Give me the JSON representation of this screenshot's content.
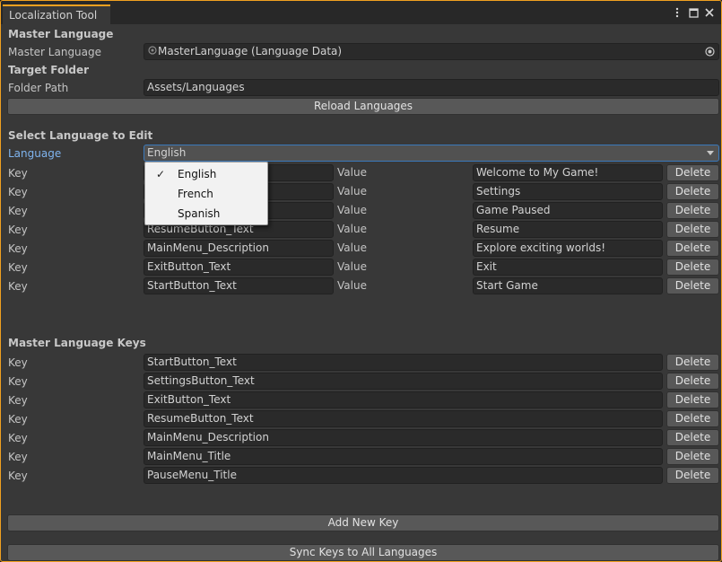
{
  "window": {
    "tab_title": "Localization Tool",
    "icons": [
      "kebab-menu-icon",
      "maximize-icon",
      "close-icon"
    ]
  },
  "master_language_section": {
    "header": "Master Language",
    "field_label": "Master Language",
    "field_value": "MasterLanguage (Language Data)"
  },
  "target_folder_section": {
    "header": "Target Folder",
    "field_label": "Folder Path",
    "field_value": "Assets/Languages"
  },
  "reload_button": "Reload Languages",
  "select_language_section": {
    "header": "Select Language to Edit",
    "language_label": "Language",
    "selected_language": "English",
    "dropdown_options": [
      "English",
      "French",
      "Spanish"
    ]
  },
  "language_entries": [
    {
      "key_label": "Key",
      "key": "",
      "value_label": "Value",
      "value": "Welcome to My Game!",
      "delete": "Delete"
    },
    {
      "key_label": "Key",
      "key": "",
      "value_label": "Value",
      "value": "Settings",
      "delete": "Delete"
    },
    {
      "key_label": "Key",
      "key": "",
      "value_label": "Value",
      "value": "Game Paused",
      "delete": "Delete"
    },
    {
      "key_label": "Key",
      "key": "ResumeButton_Text",
      "value_label": "Value",
      "value": "Resume",
      "delete": "Delete"
    },
    {
      "key_label": "Key",
      "key": "MainMenu_Description",
      "value_label": "Value",
      "value": "Explore exciting worlds!",
      "delete": "Delete"
    },
    {
      "key_label": "Key",
      "key": "ExitButton_Text",
      "value_label": "Value",
      "value": "Exit",
      "delete": "Delete"
    },
    {
      "key_label": "Key",
      "key": "StartButton_Text",
      "value_label": "Value",
      "value": "Start Game",
      "delete": "Delete"
    }
  ],
  "master_keys_section": {
    "header": "Master Language Keys",
    "keys": [
      {
        "key_label": "Key",
        "key": "StartButton_Text",
        "delete": "Delete"
      },
      {
        "key_label": "Key",
        "key": "SettingsButton_Text",
        "delete": "Delete"
      },
      {
        "key_label": "Key",
        "key": "ExitButton_Text",
        "delete": "Delete"
      },
      {
        "key_label": "Key",
        "key": "ResumeButton_Text",
        "delete": "Delete"
      },
      {
        "key_label": "Key",
        "key": "MainMenu_Description",
        "delete": "Delete"
      },
      {
        "key_label": "Key",
        "key": "MainMenu_Title",
        "delete": "Delete"
      },
      {
        "key_label": "Key",
        "key": "PauseMenu_Title",
        "delete": "Delete"
      }
    ]
  },
  "add_new_key_button": "Add New Key",
  "sync_keys_button": "Sync Keys to All Languages",
  "colors": {
    "window_bg": "#383838",
    "focus_outline": "#f0a020",
    "accent_blue": "#7fb4ef",
    "field_bg": "#2a2a2a",
    "button_bg": "#585858"
  }
}
